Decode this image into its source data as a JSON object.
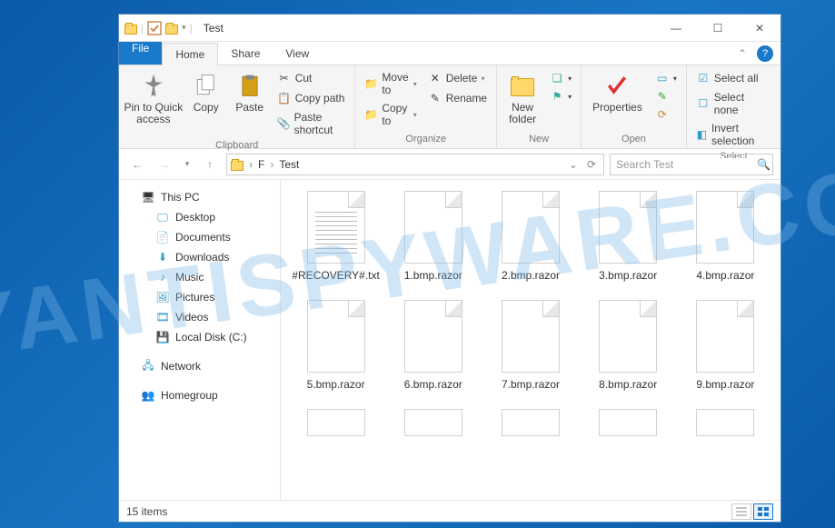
{
  "window": {
    "title": "Test",
    "minimize": "—",
    "maximize": "☐",
    "close": "✕"
  },
  "tabs": {
    "file": "File",
    "home": "Home",
    "share": "Share",
    "view": "View"
  },
  "ribbon": {
    "clipboard": {
      "label": "Clipboard",
      "pin": "Pin to Quick\naccess",
      "copy": "Copy",
      "paste": "Paste",
      "cut": "Cut",
      "copypath": "Copy path",
      "pasteshortcut": "Paste shortcut"
    },
    "organize": {
      "label": "Organize",
      "moveto": "Move to",
      "copyto": "Copy to",
      "delete": "Delete",
      "rename": "Rename"
    },
    "new": {
      "label": "New",
      "newfolder": "New\nfolder"
    },
    "open": {
      "label": "Open",
      "properties": "Properties"
    },
    "select": {
      "label": "Select",
      "selectall": "Select all",
      "selectnone": "Select none",
      "invert": "Invert selection"
    }
  },
  "breadcrumb": {
    "part1": "F",
    "part2": "Test"
  },
  "search": {
    "placeholder": "Search Test"
  },
  "nav": {
    "thispc": "This PC",
    "desktop": "Desktop",
    "documents": "Documents",
    "downloads": "Downloads",
    "music": "Music",
    "pictures": "Pictures",
    "videos": "Videos",
    "localdisk": "Local Disk (C:)",
    "network": "Network",
    "homegroup": "Homegroup"
  },
  "files": [
    {
      "name": "#RECOVERY#.txt",
      "type": "txt"
    },
    {
      "name": "1.bmp.razor",
      "type": "blank"
    },
    {
      "name": "2.bmp.razor",
      "type": "blank"
    },
    {
      "name": "3.bmp.razor",
      "type": "blank"
    },
    {
      "name": "4.bmp.razor",
      "type": "blank"
    },
    {
      "name": "5.bmp.razor",
      "type": "blank"
    },
    {
      "name": "6.bmp.razor",
      "type": "blank"
    },
    {
      "name": "7.bmp.razor",
      "type": "blank"
    },
    {
      "name": "8.bmp.razor",
      "type": "blank"
    },
    {
      "name": "9.bmp.razor",
      "type": "blank"
    }
  ],
  "status": {
    "count": "15 items"
  },
  "watermark": "MYANTISPYWARE.COM"
}
